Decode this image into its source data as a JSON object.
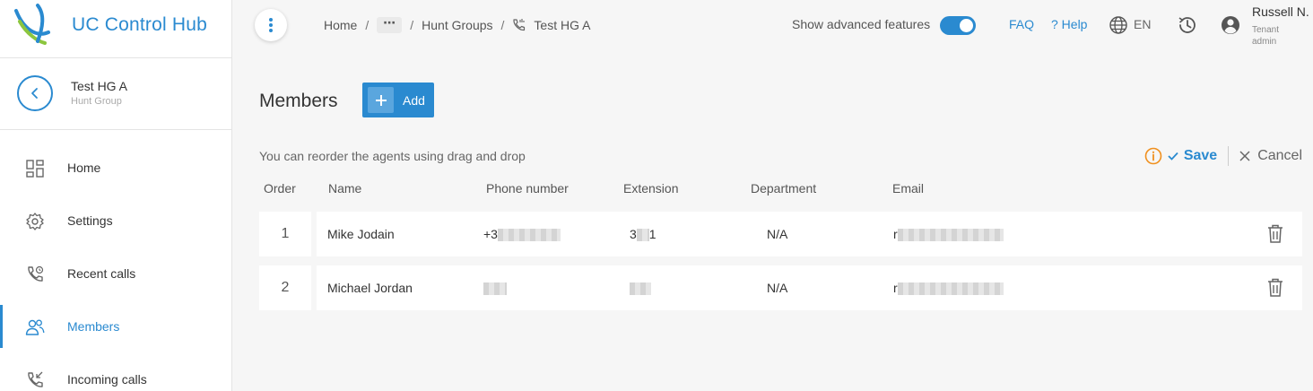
{
  "app": {
    "name": "UC Control Hub"
  },
  "context": {
    "title": "Test HG A",
    "subtitle": "Hunt Group"
  },
  "sidebar": {
    "items": [
      {
        "label": "Home",
        "icon": "dashboard-icon",
        "active": false
      },
      {
        "label": "Settings",
        "icon": "gear-icon",
        "active": false
      },
      {
        "label": "Recent calls",
        "icon": "phone-history-icon",
        "active": false
      },
      {
        "label": "Members",
        "icon": "users-icon",
        "active": true
      },
      {
        "label": "Incoming calls",
        "icon": "incoming-call-icon",
        "active": false
      }
    ]
  },
  "breadcrumb": {
    "home": "Home",
    "ellipsis": "⋯",
    "section": "Hunt Groups",
    "current": "Test HG A"
  },
  "header": {
    "advanced_label": "Show advanced features",
    "advanced_enabled": true,
    "faq": "FAQ",
    "help": "? Help",
    "language": "EN",
    "user_name": "Russell N.",
    "user_role": "Tenant admin"
  },
  "main": {
    "title": "Members",
    "add_label": "Add",
    "hint": "You can reorder the agents using drag and drop",
    "save_label": "Save",
    "cancel_label": "Cancel"
  },
  "table": {
    "columns": [
      "Order",
      "Name",
      "Phone number",
      "Extension",
      "Department",
      "Email"
    ],
    "rows": [
      {
        "order": "1",
        "name": "Mike Jodain",
        "phone_prefix": "+3",
        "extension_prefix": "3",
        "extension_suffix": "1",
        "department": "N/A",
        "email_prefix": "r"
      },
      {
        "order": "2",
        "name": "Michael Jordan",
        "phone_prefix": "",
        "extension_prefix": "",
        "extension_suffix": "",
        "department": "N/A",
        "email_prefix": "r"
      }
    ]
  },
  "colors": {
    "accent": "#2a8ad0",
    "warning": "#f0901e",
    "background": "#f6f6f6"
  }
}
